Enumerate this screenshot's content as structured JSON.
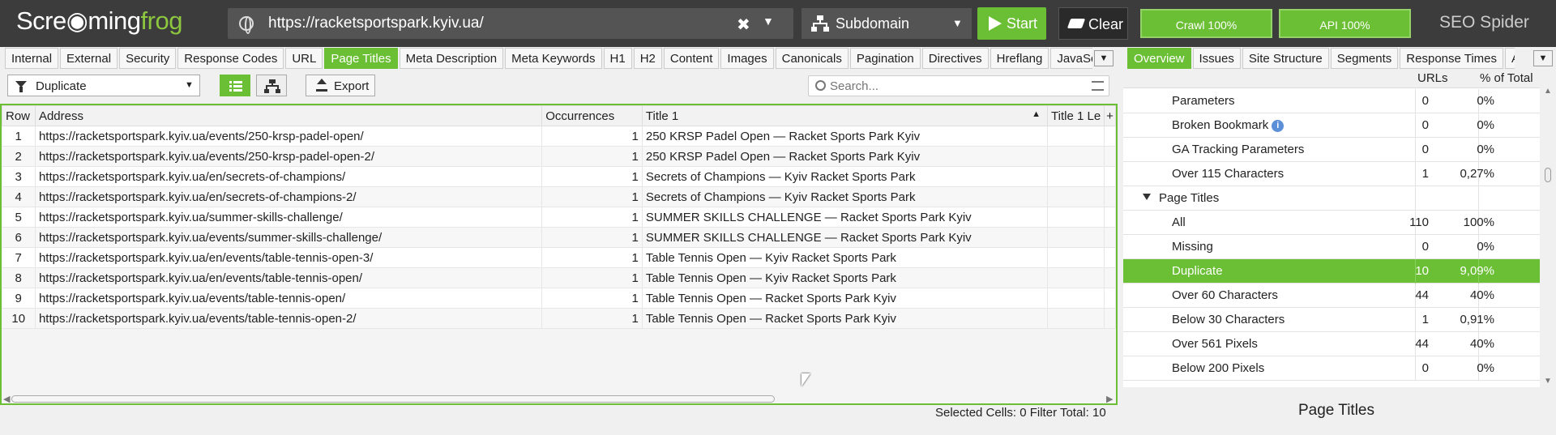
{
  "app": {
    "logo_a": "Scre",
    "logo_b": "ming",
    "logo_c": "frog",
    "brand": "SEO Spider"
  },
  "toolbar": {
    "url": "https://racketsportspark.kyiv.ua/",
    "mode": "Subdomain",
    "start_label": "Start",
    "clear_label": "Clear",
    "crawl_progress": "Crawl 100%",
    "api_progress": "API 100%"
  },
  "left_tabs": [
    "Internal",
    "External",
    "Security",
    "Response Codes",
    "URL",
    "Page Titles",
    "Meta Description",
    "Meta Keywords",
    "H1",
    "H2",
    "Content",
    "Images",
    "Canonicals",
    "Pagination",
    "Directives",
    "Hreflang",
    "JavaScr"
  ],
  "right_tabs": [
    "Overview",
    "Issues",
    "Site Structure",
    "Segments",
    "Response Times",
    "API"
  ],
  "filter": {
    "selected": "Duplicate",
    "export_label": "Export",
    "search_placeholder": "Search..."
  },
  "table": {
    "headers": {
      "row": "Row",
      "address": "Address",
      "occurrences": "Occurrences",
      "title1": "Title 1",
      "title1_len": "Title 1 Le"
    },
    "rows": [
      {
        "row": "1",
        "address": "https://racketsportspark.kyiv.ua/events/250-krsp-padel-open/",
        "occ": "1",
        "title": "250 KRSP Padel Open — Racket Sports Park Kyiv"
      },
      {
        "row": "2",
        "address": "https://racketsportspark.kyiv.ua/events/250-krsp-padel-open-2/",
        "occ": "1",
        "title": "250 KRSP Padel Open — Racket Sports Park Kyiv"
      },
      {
        "row": "3",
        "address": "https://racketsportspark.kyiv.ua/en/secrets-of-champions/",
        "occ": "1",
        "title": "Secrets of Champions — Kyiv Racket Sports Park"
      },
      {
        "row": "4",
        "address": "https://racketsportspark.kyiv.ua/en/secrets-of-champions-2/",
        "occ": "1",
        "title": "Secrets of Champions — Kyiv Racket Sports Park"
      },
      {
        "row": "5",
        "address": "https://racketsportspark.kyiv.ua/summer-skills-challenge/",
        "occ": "1",
        "title": "SUMMER SKILLS CHALLENGE — Racket Sports Park Kyiv"
      },
      {
        "row": "6",
        "address": "https://racketsportspark.kyiv.ua/events/summer-skills-challenge/",
        "occ": "1",
        "title": "SUMMER SKILLS CHALLENGE — Racket Sports Park Kyiv"
      },
      {
        "row": "7",
        "address": "https://racketsportspark.kyiv.ua/en/events/table-tennis-open-3/",
        "occ": "1",
        "title": "Table Tennis Open — Kyiv Racket Sports Park"
      },
      {
        "row": "8",
        "address": "https://racketsportspark.kyiv.ua/en/events/table-tennis-open/",
        "occ": "1",
        "title": "Table Tennis Open — Kyiv Racket Sports Park"
      },
      {
        "row": "9",
        "address": "https://racketsportspark.kyiv.ua/events/table-tennis-open/",
        "occ": "1",
        "title": "Table Tennis Open — Racket Sports Park Kyiv"
      },
      {
        "row": "10",
        "address": "https://racketsportspark.kyiv.ua/events/table-tennis-open-2/",
        "occ": "1",
        "title": "Table Tennis Open — Racket Sports Park Kyiv"
      }
    ]
  },
  "status": {
    "text": "Selected Cells:  0  Filter Total:  10"
  },
  "overview": {
    "col_urls": "URLs",
    "col_pct": "% of Total",
    "rows": [
      {
        "name": "Parameters",
        "urls": "0",
        "pct": "0%"
      },
      {
        "name": "Broken Bookmark",
        "urls": "0",
        "pct": "0%",
        "info": "i"
      },
      {
        "name": "GA Tracking Parameters",
        "urls": "0",
        "pct": "0%"
      },
      {
        "name": "Over 115 Characters",
        "urls": "1",
        "pct": "0,27%"
      },
      {
        "name": "Page Titles",
        "urls": "",
        "pct": ""
      },
      {
        "name": "All",
        "urls": "110",
        "pct": "100%"
      },
      {
        "name": "Missing",
        "urls": "0",
        "pct": "0%"
      },
      {
        "name": "Duplicate",
        "urls": "10",
        "pct": "9,09%"
      },
      {
        "name": "Over 60 Characters",
        "urls": "44",
        "pct": "40%"
      },
      {
        "name": "Below 30 Characters",
        "urls": "1",
        "pct": "0,91%"
      },
      {
        "name": "Over 561 Pixels",
        "urls": "44",
        "pct": "40%"
      },
      {
        "name": "Below 200 Pixels",
        "urls": "0",
        "pct": "0%"
      }
    ],
    "panel_title": "Page Titles"
  },
  "colors": {
    "accent": "#6bbf35",
    "topbar": "#3c3c3c"
  }
}
